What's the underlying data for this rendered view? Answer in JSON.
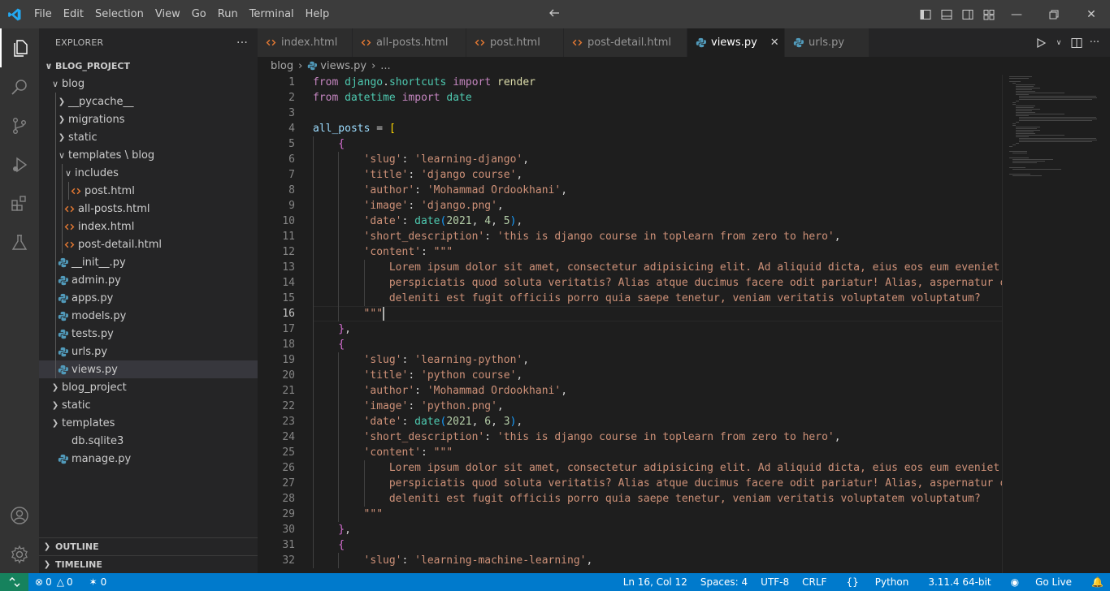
{
  "menu": [
    "File",
    "Edit",
    "Selection",
    "View",
    "Go",
    "Run",
    "Terminal",
    "Help"
  ],
  "explorer": {
    "title": "EXPLORER",
    "root": "BLOG_PROJECT",
    "items": [
      {
        "label": "blog",
        "depth": 1,
        "kind": "folder-open"
      },
      {
        "label": "__pycache__",
        "depth": 2,
        "kind": "folder"
      },
      {
        "label": "migrations",
        "depth": 2,
        "kind": "folder"
      },
      {
        "label": "static",
        "depth": 2,
        "kind": "folder"
      },
      {
        "label": "templates \\ blog",
        "depth": 2,
        "kind": "folder-open"
      },
      {
        "label": "includes",
        "depth": 3,
        "kind": "folder-open"
      },
      {
        "label": "post.html",
        "depth": 4,
        "kind": "html"
      },
      {
        "label": "all-posts.html",
        "depth": 3,
        "kind": "html"
      },
      {
        "label": "index.html",
        "depth": 3,
        "kind": "html"
      },
      {
        "label": "post-detail.html",
        "depth": 3,
        "kind": "html"
      },
      {
        "label": "__init__.py",
        "depth": 2,
        "kind": "py"
      },
      {
        "label": "admin.py",
        "depth": 2,
        "kind": "py"
      },
      {
        "label": "apps.py",
        "depth": 2,
        "kind": "py"
      },
      {
        "label": "models.py",
        "depth": 2,
        "kind": "py"
      },
      {
        "label": "tests.py",
        "depth": 2,
        "kind": "py"
      },
      {
        "label": "urls.py",
        "depth": 2,
        "kind": "py"
      },
      {
        "label": "views.py",
        "depth": 2,
        "kind": "py",
        "selected": true
      },
      {
        "label": "blog_project",
        "depth": 1,
        "kind": "folder"
      },
      {
        "label": "static",
        "depth": 1,
        "kind": "folder"
      },
      {
        "label": "templates",
        "depth": 1,
        "kind": "folder"
      },
      {
        "label": "db.sqlite3",
        "depth": 1,
        "kind": "db"
      },
      {
        "label": "manage.py",
        "depth": 1,
        "kind": "py"
      }
    ],
    "outline": "OUTLINE",
    "timeline": "TIMELINE"
  },
  "tabs": [
    {
      "label": "index.html",
      "kind": "html"
    },
    {
      "label": "all-posts.html",
      "kind": "html"
    },
    {
      "label": "post.html",
      "kind": "html"
    },
    {
      "label": "post-detail.html",
      "kind": "html"
    },
    {
      "label": "views.py",
      "kind": "py",
      "active": true
    },
    {
      "label": "urls.py",
      "kind": "py"
    }
  ],
  "breadcrumb": {
    "folder": "blog",
    "file": "views.py",
    "more": "..."
  },
  "editor": {
    "current_line": 16,
    "lines": [
      {
        "n": "1",
        "indent": 0,
        "tokens": [
          [
            "kw",
            "from "
          ],
          [
            "mod",
            "django"
          ],
          [
            "def",
            "."
          ],
          [
            "mod",
            "shortcuts"
          ],
          [
            "kw",
            " import "
          ],
          [
            "fn",
            "render"
          ]
        ]
      },
      {
        "n": "2",
        "indent": 0,
        "tokens": [
          [
            "kw",
            "from "
          ],
          [
            "mod",
            "datetime"
          ],
          [
            "kw",
            " import "
          ],
          [
            "mod",
            "date"
          ]
        ]
      },
      {
        "n": "3",
        "indent": 0,
        "tokens": []
      },
      {
        "n": "4",
        "indent": 0,
        "tokens": [
          [
            "var",
            "all_posts"
          ],
          [
            "def",
            " = "
          ],
          [
            "br",
            "["
          ]
        ]
      },
      {
        "n": "5",
        "indent": 1,
        "tokens": [
          [
            "br2",
            "{"
          ]
        ]
      },
      {
        "n": "6",
        "indent": 2,
        "tokens": [
          [
            "str",
            "'slug'"
          ],
          [
            "def",
            ": "
          ],
          [
            "str",
            "'learning-django'"
          ],
          [
            "def",
            ","
          ]
        ]
      },
      {
        "n": "7",
        "indent": 2,
        "tokens": [
          [
            "str",
            "'title'"
          ],
          [
            "def",
            ": "
          ],
          [
            "str",
            "'django course'"
          ],
          [
            "def",
            ","
          ]
        ]
      },
      {
        "n": "8",
        "indent": 2,
        "tokens": [
          [
            "str",
            "'author'"
          ],
          [
            "def",
            ": "
          ],
          [
            "str",
            "'Mohammad Ordookhani'"
          ],
          [
            "def",
            ","
          ]
        ]
      },
      {
        "n": "9",
        "indent": 2,
        "tokens": [
          [
            "str",
            "'image'"
          ],
          [
            "def",
            ": "
          ],
          [
            "str",
            "'django.png'"
          ],
          [
            "def",
            ","
          ]
        ]
      },
      {
        "n": "10",
        "indent": 2,
        "tokens": [
          [
            "str",
            "'date'"
          ],
          [
            "def",
            ": "
          ],
          [
            "mod",
            "date"
          ],
          [
            "br3",
            "("
          ],
          [
            "num",
            "2021"
          ],
          [
            "def",
            ", "
          ],
          [
            "num",
            "4"
          ],
          [
            "def",
            ", "
          ],
          [
            "num",
            "5"
          ],
          [
            "br3",
            ")"
          ],
          [
            "def",
            ","
          ]
        ]
      },
      {
        "n": "11",
        "indent": 2,
        "tokens": [
          [
            "str",
            "'short_description'"
          ],
          [
            "def",
            ": "
          ],
          [
            "str",
            "'this is django course in toplearn from zero to hero'"
          ],
          [
            "def",
            ","
          ]
        ]
      },
      {
        "n": "12",
        "indent": 2,
        "tokens": [
          [
            "str",
            "'content'"
          ],
          [
            "def",
            ": "
          ],
          [
            "str",
            "\"\"\""
          ]
        ]
      },
      {
        "n": "13",
        "indent": 3,
        "tokens": [
          [
            "str",
            "Lorem ipsum dolor sit amet, consectetur adipisicing elit. Ad aliquid dicta, eius eos eum eveniet"
          ]
        ]
      },
      {
        "n": "14",
        "indent": 3,
        "tokens": [
          [
            "str",
            "perspiciatis quod soluta veritatis? Alias atque ducimus facere odit pariatur! Alias, aspernatur con"
          ]
        ]
      },
      {
        "n": "15",
        "indent": 3,
        "tokens": [
          [
            "str",
            "deleniti est fugit officiis porro quia saepe tenetur, veniam veritatis voluptatem voluptatum?"
          ]
        ]
      },
      {
        "n": "16",
        "indent": 2,
        "tokens": [
          [
            "str",
            "\"\"\""
          ]
        ],
        "cursor": true
      },
      {
        "n": "17",
        "indent": 1,
        "tokens": [
          [
            "br2",
            "}"
          ],
          [
            "def",
            ","
          ]
        ]
      },
      {
        "n": "18",
        "indent": 1,
        "tokens": [
          [
            "br2",
            "{"
          ]
        ]
      },
      {
        "n": "19",
        "indent": 2,
        "tokens": [
          [
            "str",
            "'slug'"
          ],
          [
            "def",
            ": "
          ],
          [
            "str",
            "'learning-python'"
          ],
          [
            "def",
            ","
          ]
        ]
      },
      {
        "n": "20",
        "indent": 2,
        "tokens": [
          [
            "str",
            "'title'"
          ],
          [
            "def",
            ": "
          ],
          [
            "str",
            "'python course'"
          ],
          [
            "def",
            ","
          ]
        ]
      },
      {
        "n": "21",
        "indent": 2,
        "tokens": [
          [
            "str",
            "'author'"
          ],
          [
            "def",
            ": "
          ],
          [
            "str",
            "'Mohammad Ordookhani'"
          ],
          [
            "def",
            ","
          ]
        ]
      },
      {
        "n": "22",
        "indent": 2,
        "tokens": [
          [
            "str",
            "'image'"
          ],
          [
            "def",
            ": "
          ],
          [
            "str",
            "'python.png'"
          ],
          [
            "def",
            ","
          ]
        ]
      },
      {
        "n": "23",
        "indent": 2,
        "tokens": [
          [
            "str",
            "'date'"
          ],
          [
            "def",
            ": "
          ],
          [
            "mod",
            "date"
          ],
          [
            "br3",
            "("
          ],
          [
            "num",
            "2021"
          ],
          [
            "def",
            ", "
          ],
          [
            "num",
            "6"
          ],
          [
            "def",
            ", "
          ],
          [
            "num",
            "3"
          ],
          [
            "br3",
            ")"
          ],
          [
            "def",
            ","
          ]
        ]
      },
      {
        "n": "24",
        "indent": 2,
        "tokens": [
          [
            "str",
            "'short_description'"
          ],
          [
            "def",
            ": "
          ],
          [
            "str",
            "'this is django course in toplearn from zero to hero'"
          ],
          [
            "def",
            ","
          ]
        ]
      },
      {
        "n": "25",
        "indent": 2,
        "tokens": [
          [
            "str",
            "'content'"
          ],
          [
            "def",
            ": "
          ],
          [
            "str",
            "\"\"\""
          ]
        ]
      },
      {
        "n": "26",
        "indent": 3,
        "tokens": [
          [
            "str",
            "Lorem ipsum dolor sit amet, consectetur adipisicing elit. Ad aliquid dicta, eius eos eum eveniet"
          ]
        ]
      },
      {
        "n": "27",
        "indent": 3,
        "tokens": [
          [
            "str",
            "perspiciatis quod soluta veritatis? Alias atque ducimus facere odit pariatur! Alias, aspernatur con"
          ]
        ]
      },
      {
        "n": "28",
        "indent": 3,
        "tokens": [
          [
            "str",
            "deleniti est fugit officiis porro quia saepe tenetur, veniam veritatis voluptatem voluptatum?"
          ]
        ]
      },
      {
        "n": "29",
        "indent": 2,
        "tokens": [
          [
            "str",
            "\"\"\""
          ]
        ]
      },
      {
        "n": "30",
        "indent": 1,
        "tokens": [
          [
            "br2",
            "}"
          ],
          [
            "def",
            ","
          ]
        ]
      },
      {
        "n": "31",
        "indent": 1,
        "tokens": [
          [
            "br2",
            "{"
          ]
        ]
      },
      {
        "n": "32",
        "indent": 2,
        "tokens": [
          [
            "str",
            "'slug'"
          ],
          [
            "def",
            ": "
          ],
          [
            "str",
            "'learning-machine-learning'"
          ],
          [
            "def",
            ","
          ]
        ]
      }
    ]
  },
  "status": {
    "errors": "0",
    "warnings": "0",
    "ports": "0",
    "position": "Ln 16, Col 12",
    "spaces": "Spaces: 4",
    "encoding": "UTF-8",
    "eol": "CRLF",
    "language": "Python",
    "interpreter": "3.11.4 64-bit",
    "live": "Go Live"
  },
  "colors": {
    "accent": "#007acc",
    "remote": "#16825d",
    "html_icon": "#e37933",
    "py_icon": "#519aba"
  }
}
